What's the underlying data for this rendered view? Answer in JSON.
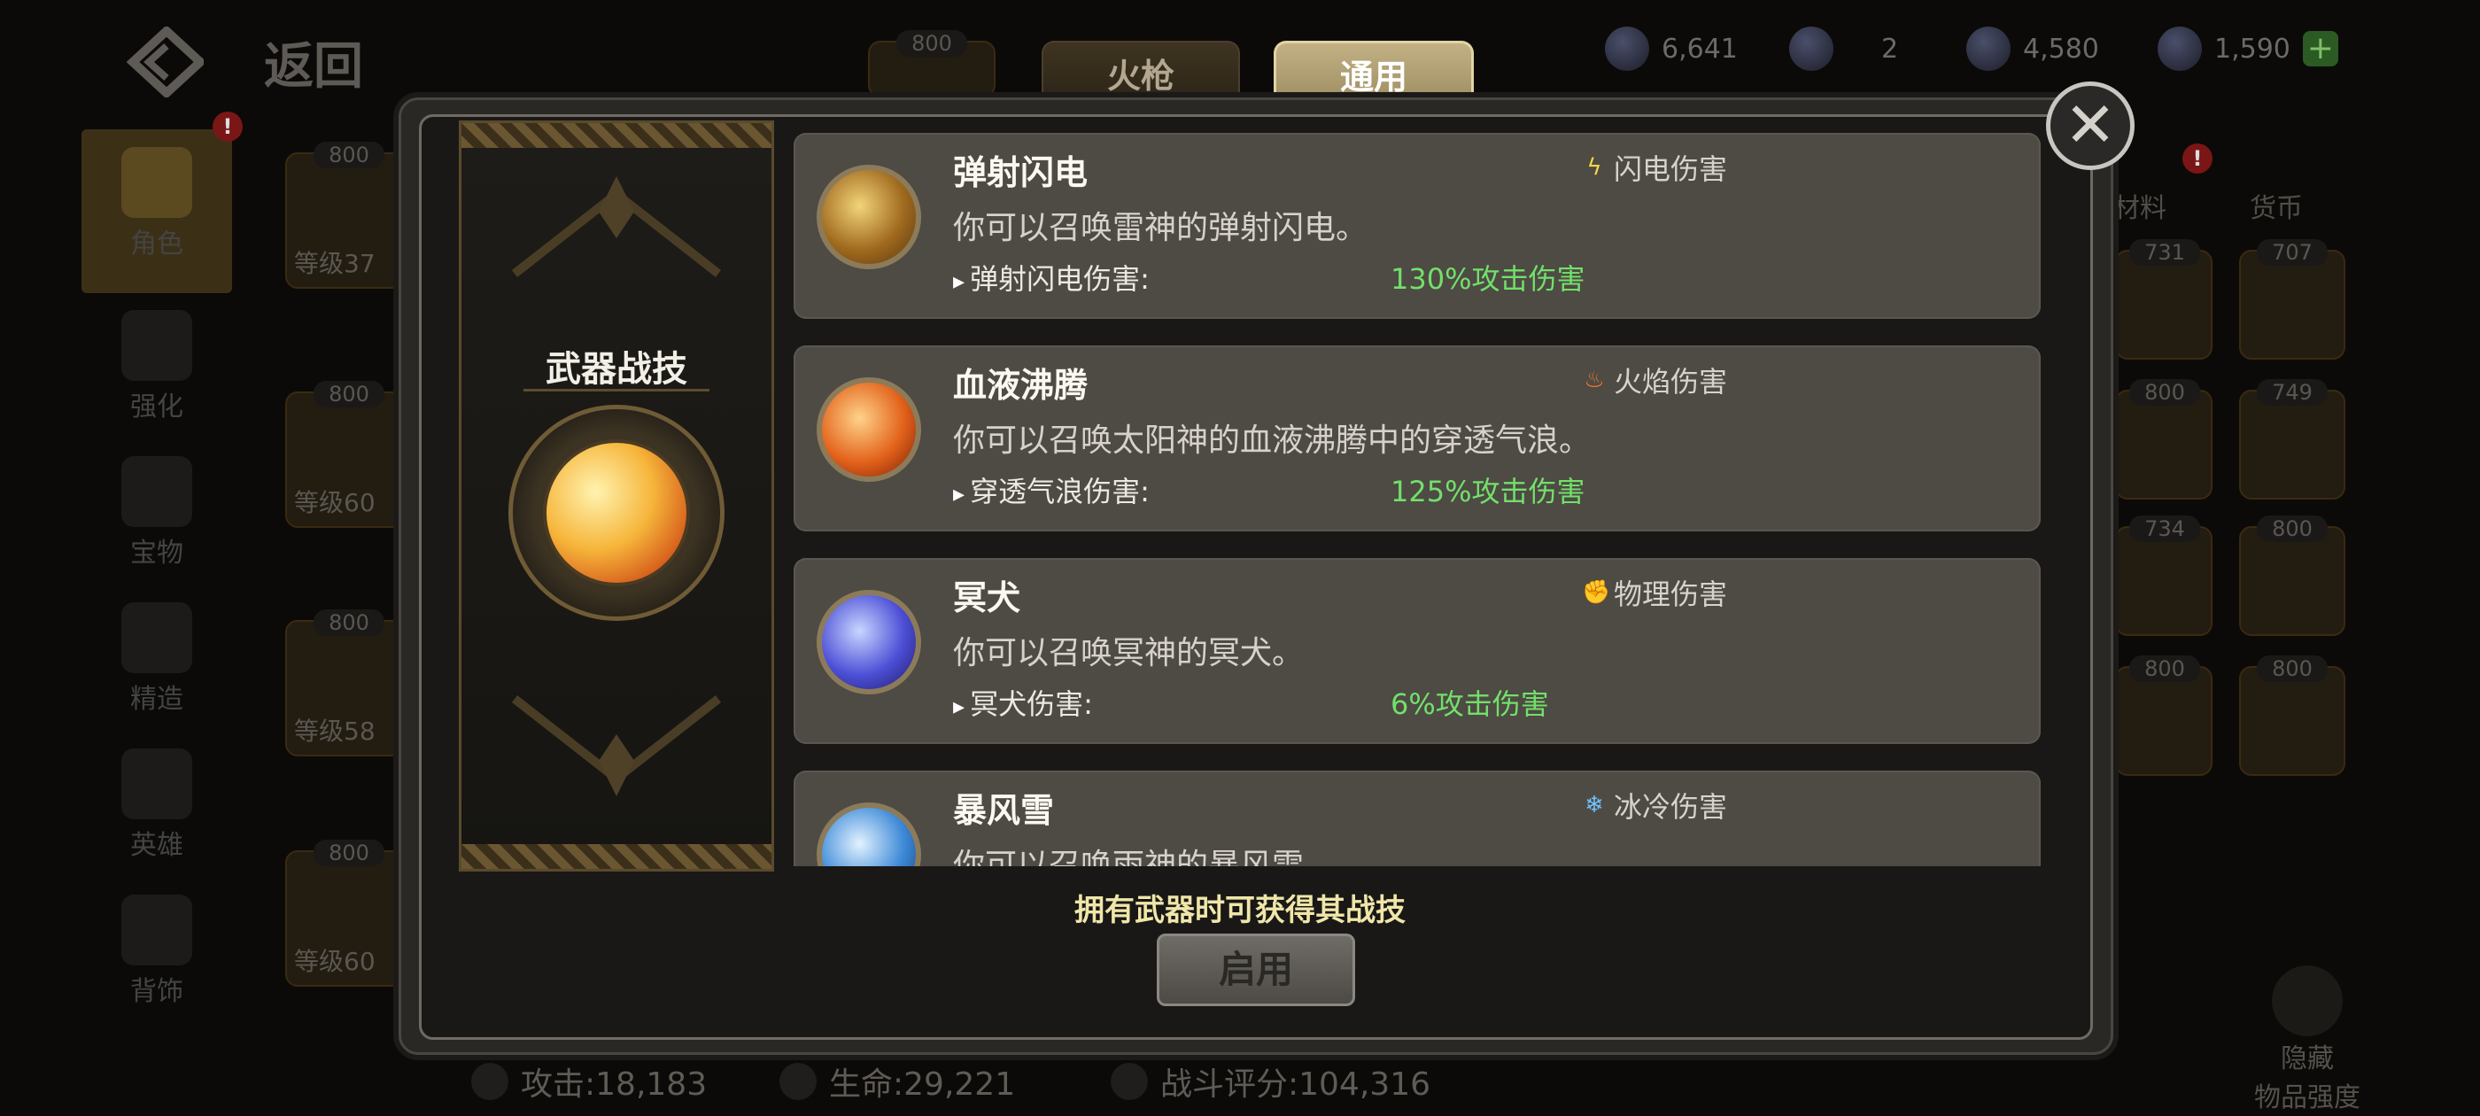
{
  "header": {
    "back_label": "返回"
  },
  "resources": [
    {
      "icon": "silver-coin-icon",
      "value": "6,641"
    },
    {
      "icon": "gem-shell-icon",
      "value": "2"
    },
    {
      "icon": "locked-gem-icon",
      "value": "4,580"
    },
    {
      "icon": "gold-gem-icon",
      "value": "1,590"
    }
  ],
  "sidebar": {
    "items": [
      {
        "label": "角色",
        "active": true
      },
      {
        "label": "强化"
      },
      {
        "label": "宝物"
      },
      {
        "label": "精造"
      },
      {
        "label": "英雄"
      },
      {
        "label": "背饰"
      }
    ]
  },
  "background_slots": {
    "left": [
      {
        "tag": "800",
        "level": "等级37"
      },
      {
        "tag": "800",
        "level": "等级60"
      },
      {
        "tag": "800",
        "level": "等级58"
      },
      {
        "tag": "800",
        "level": "等级60"
      }
    ],
    "top_tag": "800",
    "right_tabs": [
      "材料",
      "货币"
    ],
    "right_tags": [
      "731",
      "707",
      "800",
      "749",
      "734",
      "800",
      "800",
      "800"
    ]
  },
  "stats": {
    "attack": "攻击:18,183",
    "hp": "生命:29,221",
    "score": "战斗评分:104,316"
  },
  "hidden_button": {
    "line1": "隐藏",
    "line2": "物品强度"
  },
  "tabs": [
    {
      "label": "火枪",
      "active": false
    },
    {
      "label": "通用",
      "active": true
    }
  ],
  "modal": {
    "panel_title": "武器战技",
    "skills": [
      {
        "name": "弹射闪电",
        "type_icon": "lightning-icon",
        "type": "闪电伤害",
        "description": "你可以召唤雷神的弹射闪电。",
        "stat_label": "弹射闪电伤害:",
        "stat_value": "130%攻击伤害",
        "colors": [
          "#f2d47a",
          "#a06a1e",
          "#5a3510"
        ]
      },
      {
        "name": "血液沸腾",
        "type_icon": "fire-icon",
        "type": "火焰伤害",
        "description": "你可以召唤太阳神的血液沸腾中的穿透气浪。",
        "stat_label": "穿透气浪伤害:",
        "stat_value": "125%攻击伤害",
        "colors": [
          "#ffd28a",
          "#e2621a",
          "#7a1c08"
        ]
      },
      {
        "name": "冥犬",
        "type_icon": "fist-icon",
        "type": "物理伤害",
        "description": "你可以召唤冥神的冥犬。",
        "stat_label": "冥犬伤害:",
        "stat_value": "6%攻击伤害",
        "colors": [
          "#c7d6ff",
          "#4d4fd6",
          "#1d1a66"
        ]
      },
      {
        "name": "暴风雪",
        "type_icon": "snowflake-icon",
        "type": "冰冷伤害",
        "description": "你可以召唤雨神的暴风雪",
        "stat_label": "",
        "stat_value": "",
        "colors": [
          "#e2f2ff",
          "#3e8ad8",
          "#123a78"
        ]
      }
    ],
    "footer_note": "拥有武器时可获得其战技",
    "enable_button": "启用"
  }
}
